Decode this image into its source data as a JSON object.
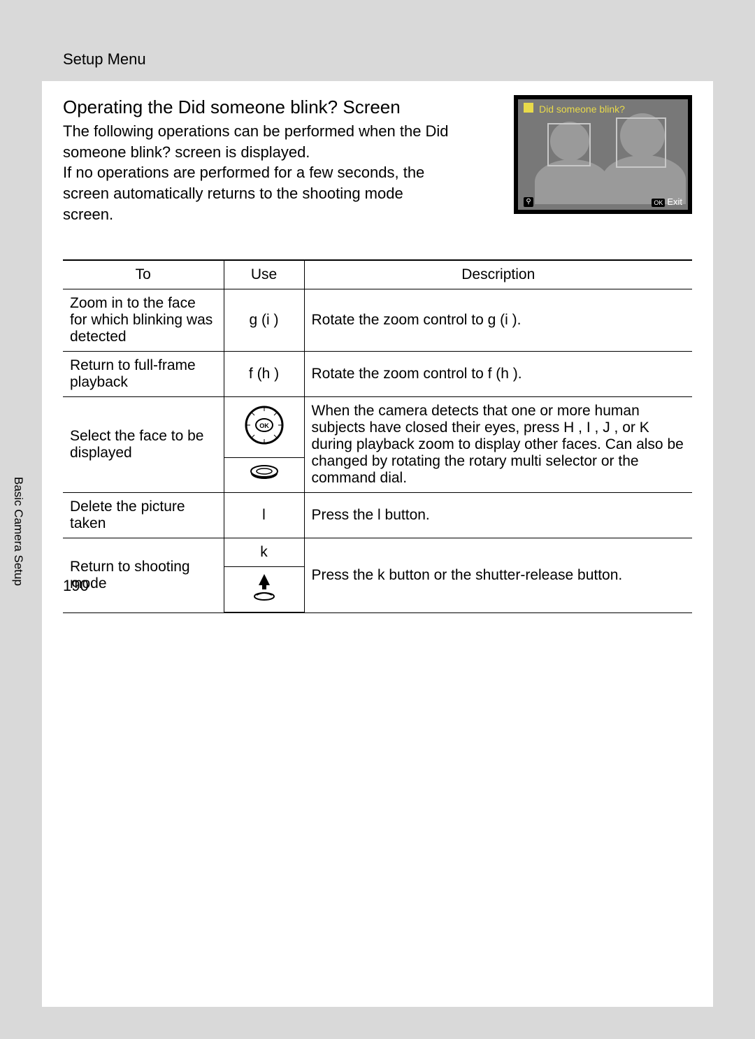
{
  "header": {
    "section": "Setup Menu"
  },
  "title": "Operating the Did someone blink? Screen",
  "paragraph1": "The following operations can be performed when the Did someone blink? screen is displayed.",
  "paragraph2": "If no operations are performed for a few seconds, the screen automatically returns to the shooting mode screen.",
  "screen": {
    "title": "Did someone blink?",
    "exit_label": "Exit",
    "ok_label": "OK"
  },
  "table": {
    "headers": {
      "to": "To",
      "use": "Use",
      "desc": "Description"
    },
    "rows": {
      "zoom_in": {
        "to": "Zoom in to the face for which blinking was detected",
        "use": "g (i )",
        "desc": "Rotate the zoom control to g (i )."
      },
      "full_frame": {
        "to": "Return to full-frame playback",
        "use": "f  (h  )",
        "desc": "Rotate the zoom control to f  (h  )."
      },
      "select_face": {
        "to": "Select the face to be displayed",
        "desc": "When the camera detects that one or more human subjects have closed their eyes, press H , I , J , or K during playback zoom to display other faces. Can also be changed by rotating the rotary multi selector or the command dial."
      },
      "delete": {
        "to": "Delete the picture taken",
        "use": "l",
        "desc": "Press the l  button."
      },
      "return_shoot": {
        "to": "Return to shooting mode",
        "use": "k",
        "desc": "Press the k  button or the shutter-release button."
      }
    }
  },
  "side_label": "Basic Camera Setup",
  "page_number": "190"
}
